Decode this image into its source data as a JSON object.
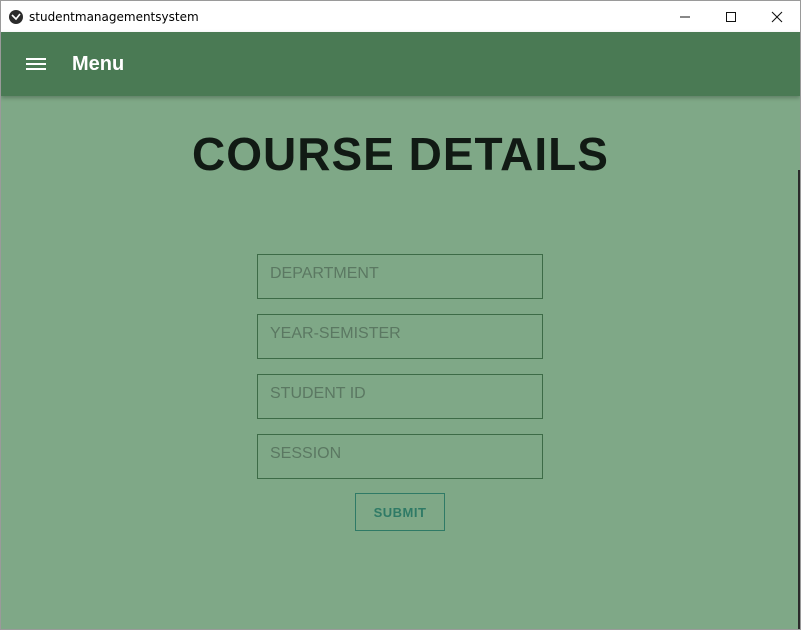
{
  "window": {
    "title": "studentmanagementsystem",
    "controls": [
      "minimize-icon",
      "maximize-icon",
      "close-icon"
    ]
  },
  "toolbar": {
    "menu_icon": "hamburger-menu-icon",
    "title": "Menu"
  },
  "page": {
    "title": "COURSE DETAILS"
  },
  "form": {
    "fields": [
      {
        "name": "department",
        "placeholder": "DEPARTMENT",
        "value": ""
      },
      {
        "name": "year-semister",
        "placeholder": "YEAR-SEMISTER",
        "value": ""
      },
      {
        "name": "student-id",
        "placeholder": "STUDENT ID",
        "value": ""
      },
      {
        "name": "session",
        "placeholder": "SESSION",
        "value": ""
      }
    ],
    "submit_label": "SUBMIT"
  },
  "colors": {
    "toolbar_bg": "#4a7a54",
    "content_bg": "#7fa887",
    "field_border": "#3d6b47",
    "submit_accent": "#2f7a66"
  }
}
